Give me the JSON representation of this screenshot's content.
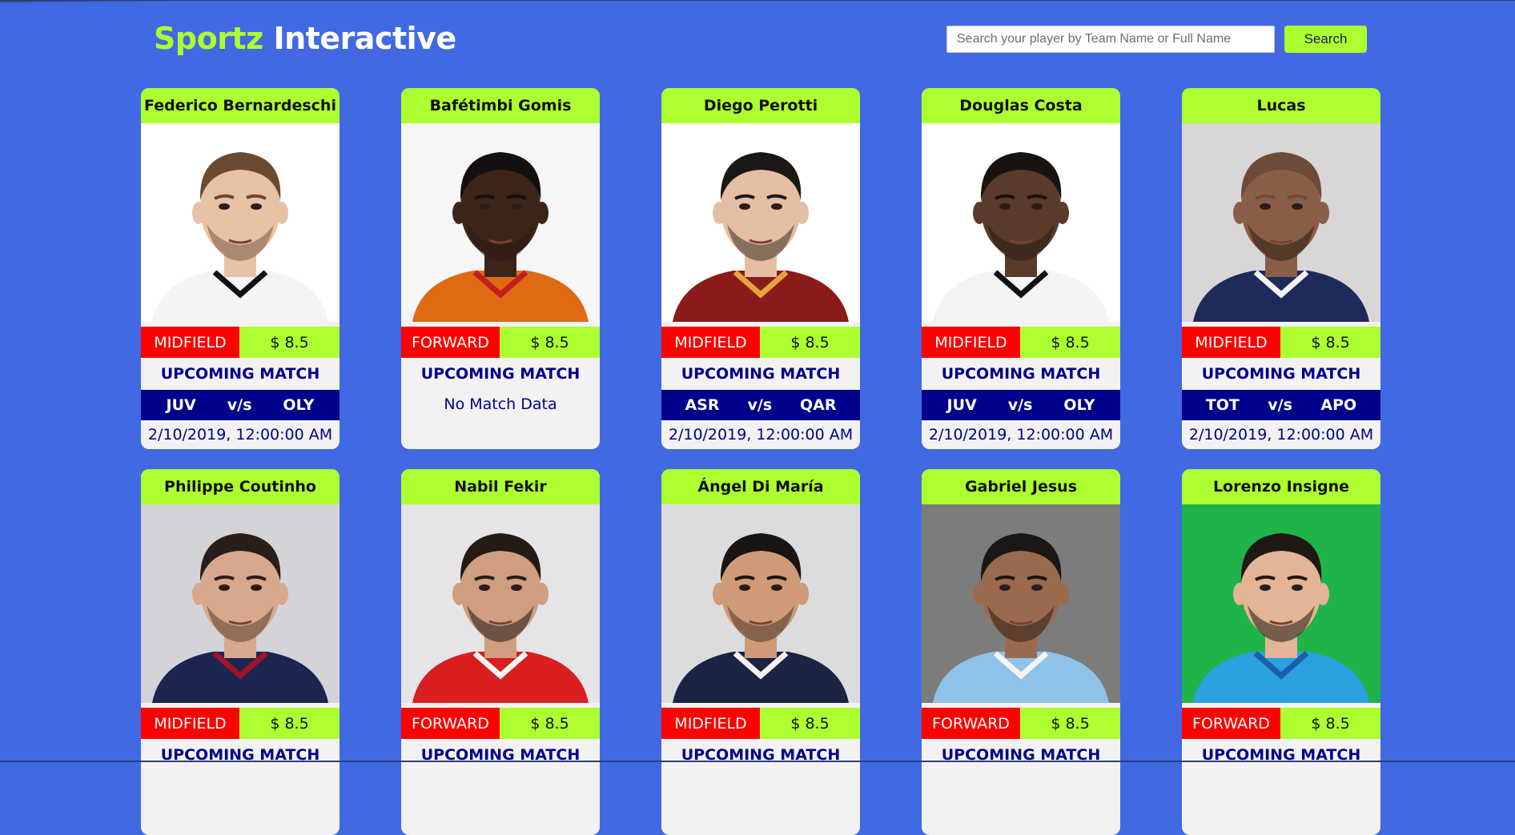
{
  "header": {
    "brand_part1": "Sportz",
    "brand_part2": "Interactive",
    "search_placeholder": "Search your player by Team Name or Full Name",
    "search_value": "",
    "search_button": "Search"
  },
  "colors": {
    "background": "#4169e1",
    "accent_green": "#adff2f",
    "position_red": "#ff0000",
    "match_navy": "#00008b",
    "card_body": "#f2f2f2"
  },
  "upcoming_label": "UPCOMING MATCH",
  "vs_label": "v/s",
  "players": [
    {
      "name": "Federico Bernardeschi",
      "position": "MIDFIELD",
      "price": "$ 8.5",
      "home": "JUV",
      "away": "OLY",
      "date": "2/10/2019, 12:00:00 AM",
      "no_match": "",
      "photo_bg": "#ffffff",
      "skin": "#e9c2a6",
      "hair": "#6b4a32",
      "beard": "#7a5a44",
      "jersey": "#f4f4f4",
      "jersey_trim": "#111111"
    },
    {
      "name": "Bafétimbi Gomis",
      "position": "FORWARD",
      "price": "$ 8.5",
      "home": "",
      "away": "",
      "date": "",
      "no_match": "No Match Data",
      "photo_bg": "#f6f6f6",
      "skin": "#3d2418",
      "hair": "#141010",
      "beard": "#2a1a12",
      "jersey": "#e06a14",
      "jersey_trim": "#c21d1d"
    },
    {
      "name": "Diego Perotti",
      "position": "MIDFIELD",
      "price": "$ 8.5",
      "home": "ASR",
      "away": "QAR",
      "date": "2/10/2019, 12:00:00 AM",
      "no_match": "",
      "photo_bg": "#ffffff",
      "skin": "#e5bea3",
      "hair": "#1d1714",
      "beard": "#3a2d26",
      "jersey": "#8b1a1a",
      "jersey_trim": "#e8a23a"
    },
    {
      "name": "Douglas Costa",
      "position": "MIDFIELD",
      "price": "$ 8.5",
      "home": "JUV",
      "away": "OLY",
      "date": "2/10/2019, 12:00:00 AM",
      "no_match": "",
      "photo_bg": "#ffffff",
      "skin": "#5a3a2a",
      "hair": "#191310",
      "beard": "#2a1c14",
      "jersey": "#f4f4f4",
      "jersey_trim": "#111111"
    },
    {
      "name": "Lucas",
      "position": "MIDFIELD",
      "price": "$ 8.5",
      "home": "TOT",
      "away": "APO",
      "date": "2/10/2019, 12:00:00 AM",
      "no_match": "",
      "photo_bg": "#d9d6d8",
      "skin": "#8a5e46",
      "hair": "#6e4a38",
      "beard": "#2a1c16",
      "jersey": "#1e2a5a",
      "jersey_trim": "#f4f4f4"
    },
    {
      "name": "Philippe Coutinho",
      "position": "MIDFIELD",
      "price": "$ 8.5",
      "home": "",
      "away": "",
      "date": "",
      "no_match": "",
      "photo_bg": "#d4d3d8",
      "skin": "#d8a88c",
      "hair": "#2a1e1a",
      "beard": "#5a3e30",
      "jersey": "#1a2550",
      "jersey_trim": "#a3122a"
    },
    {
      "name": "Nabil Fekir",
      "position": "FORWARD",
      "price": "$ 8.5",
      "home": "",
      "away": "",
      "date": "",
      "no_match": "",
      "photo_bg": "#e6e4e6",
      "skin": "#cf9e80",
      "hair": "#241a16",
      "beard": "#1e1612",
      "jersey": "#d81e1e",
      "jersey_trim": "#f4f4f4"
    },
    {
      "name": "Ángel Di María",
      "position": "MIDFIELD",
      "price": "$ 8.5",
      "home": "",
      "away": "",
      "date": "",
      "no_match": "",
      "photo_bg": "#dcdcdf",
      "skin": "#cf9a78",
      "hair": "#1a1412",
      "beard": "#4a3428",
      "jersey": "#1a2444",
      "jersey_trim": "#f4f4f4"
    },
    {
      "name": "Gabriel Jesus",
      "position": "FORWARD",
      "price": "$ 8.5",
      "home": "",
      "away": "",
      "date": "",
      "no_match": "",
      "photo_bg": "#7c7c7c",
      "skin": "#9a6a4e",
      "hair": "#1c1614",
      "beard": "#2a1c16",
      "jersey": "#8fc2e8",
      "jersey_trim": "#f4f4f4"
    },
    {
      "name": "Lorenzo Insigne",
      "position": "FORWARD",
      "price": "$ 8.5",
      "home": "",
      "away": "",
      "date": "",
      "no_match": "",
      "photo_bg": "#1fb34a",
      "skin": "#e2b596",
      "hair": "#201814",
      "beard": "#1e1612",
      "jersey": "#2aa0e0",
      "jersey_trim": "#1a5fa8"
    }
  ]
}
